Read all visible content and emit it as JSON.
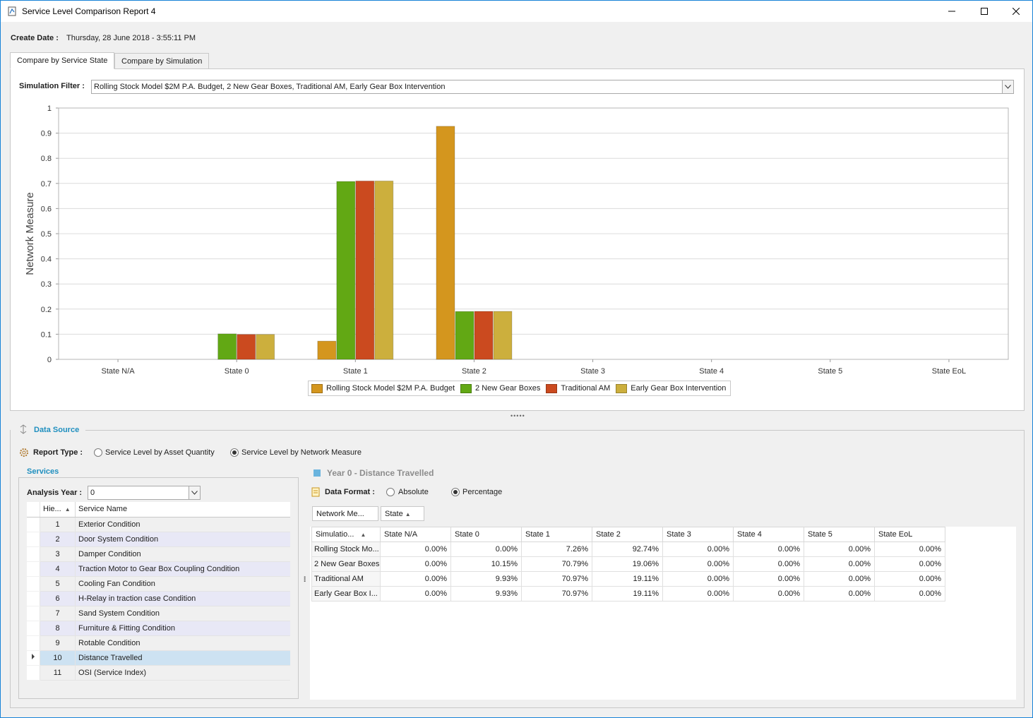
{
  "window": {
    "title": "Service Level Comparison Report 4"
  },
  "create_date": {
    "label": "Create Date :",
    "value": "Thursday, 28 June 2018 - 3:55:11 PM"
  },
  "tabs": [
    {
      "label": "Compare by Service State",
      "active": true
    },
    {
      "label": "Compare by Simulation",
      "active": false
    }
  ],
  "simulation_filter": {
    "label": "Simulation Filter :",
    "value": "Rolling Stock Model $2M P.A. Budget, 2 New Gear Boxes, Traditional AM, Early Gear Box Intervention"
  },
  "chart_data": {
    "type": "bar",
    "title": "",
    "xlabel": "",
    "ylabel": "Network Measure",
    "ylim": [
      0,
      1
    ],
    "yticks": [
      "0",
      "0.1",
      "0.2",
      "0.3",
      "0.4",
      "0.5",
      "0.6",
      "0.7",
      "0.8",
      "0.9",
      "1"
    ],
    "grid": true,
    "legend_position": "bottom-center",
    "categories": [
      "State N/A",
      "State 0",
      "State 1",
      "State 2",
      "State 3",
      "State 4",
      "State 5",
      "State EoL"
    ],
    "series": [
      {
        "name": "Rolling Stock Model $2M P.A. Budget",
        "color": "#d4961e",
        "values": [
          0,
          0,
          0.0726,
          0.9274,
          0,
          0,
          0,
          0
        ]
      },
      {
        "name": "2 New Gear Boxes",
        "color": "#62a814",
        "values": [
          0,
          0.1015,
          0.7079,
          0.1906,
          0,
          0,
          0,
          0
        ]
      },
      {
        "name": "Traditional AM",
        "color": "#cb4a1f",
        "values": [
          0,
          0.0993,
          0.7097,
          0.1911,
          0,
          0,
          0,
          0
        ]
      },
      {
        "name": "Early Gear Box Intervention",
        "color": "#ccaf3d",
        "values": [
          0,
          0.0993,
          0.7097,
          0.1911,
          0,
          0,
          0,
          0
        ]
      }
    ]
  },
  "data_source": {
    "title": "Data Source",
    "report_type_label": "Report Type :",
    "report_type_options": [
      {
        "label": "Service Level by Asset Quantity",
        "selected": false
      },
      {
        "label": "Service Level by Network Measure",
        "selected": true
      }
    ]
  },
  "services": {
    "title": "Services",
    "analysis_year_label": "Analysis Year :",
    "analysis_year_value": "0",
    "columns": [
      "Hie...",
      "Service Name"
    ],
    "rows": [
      {
        "num": "1",
        "name": "Exterior Condition"
      },
      {
        "num": "2",
        "name": "Door System Condition"
      },
      {
        "num": "3",
        "name": "Damper Condition"
      },
      {
        "num": "4",
        "name": "Traction Motor to Gear Box Coupling Condition"
      },
      {
        "num": "5",
        "name": "Cooling Fan Condition"
      },
      {
        "num": "6",
        "name": "H-Relay in traction case Condition"
      },
      {
        "num": "7",
        "name": "Sand System Condition"
      },
      {
        "num": "8",
        "name": "Furniture & Fitting Condition"
      },
      {
        "num": "9",
        "name": "Rotable Condition"
      },
      {
        "num": "10",
        "name": "Distance Travelled"
      },
      {
        "num": "11",
        "name": "OSI (Service Index)"
      }
    ],
    "selected_row": "10"
  },
  "pivot": {
    "title": "Year 0 - Distance Travelled",
    "data_format_label": "Data Format :",
    "data_format_options": [
      {
        "label": "Absolute",
        "selected": false
      },
      {
        "label": "Percentage",
        "selected": true
      }
    ],
    "filter_fields": [
      "Network Me...",
      "State"
    ],
    "row_header": "Simulatio...",
    "columns": [
      "State N/A",
      "State 0",
      "State 1",
      "State 2",
      "State 3",
      "State 4",
      "State 5",
      "State EoL"
    ],
    "rows": [
      {
        "name": "Rolling Stock Mo...",
        "values": [
          "0.00%",
          "0.00%",
          "7.26%",
          "92.74%",
          "0.00%",
          "0.00%",
          "0.00%",
          "0.00%"
        ]
      },
      {
        "name": "2 New Gear Boxes",
        "values": [
          "0.00%",
          "10.15%",
          "70.79%",
          "19.06%",
          "0.00%",
          "0.00%",
          "0.00%",
          "0.00%"
        ]
      },
      {
        "name": "Traditional AM",
        "values": [
          "0.00%",
          "9.93%",
          "70.97%",
          "19.11%",
          "0.00%",
          "0.00%",
          "0.00%",
          "0.00%"
        ]
      },
      {
        "name": "Early Gear Box I...",
        "values": [
          "0.00%",
          "9.93%",
          "70.97%",
          "19.11%",
          "0.00%",
          "0.00%",
          "0.00%",
          "0.00%"
        ]
      }
    ]
  }
}
